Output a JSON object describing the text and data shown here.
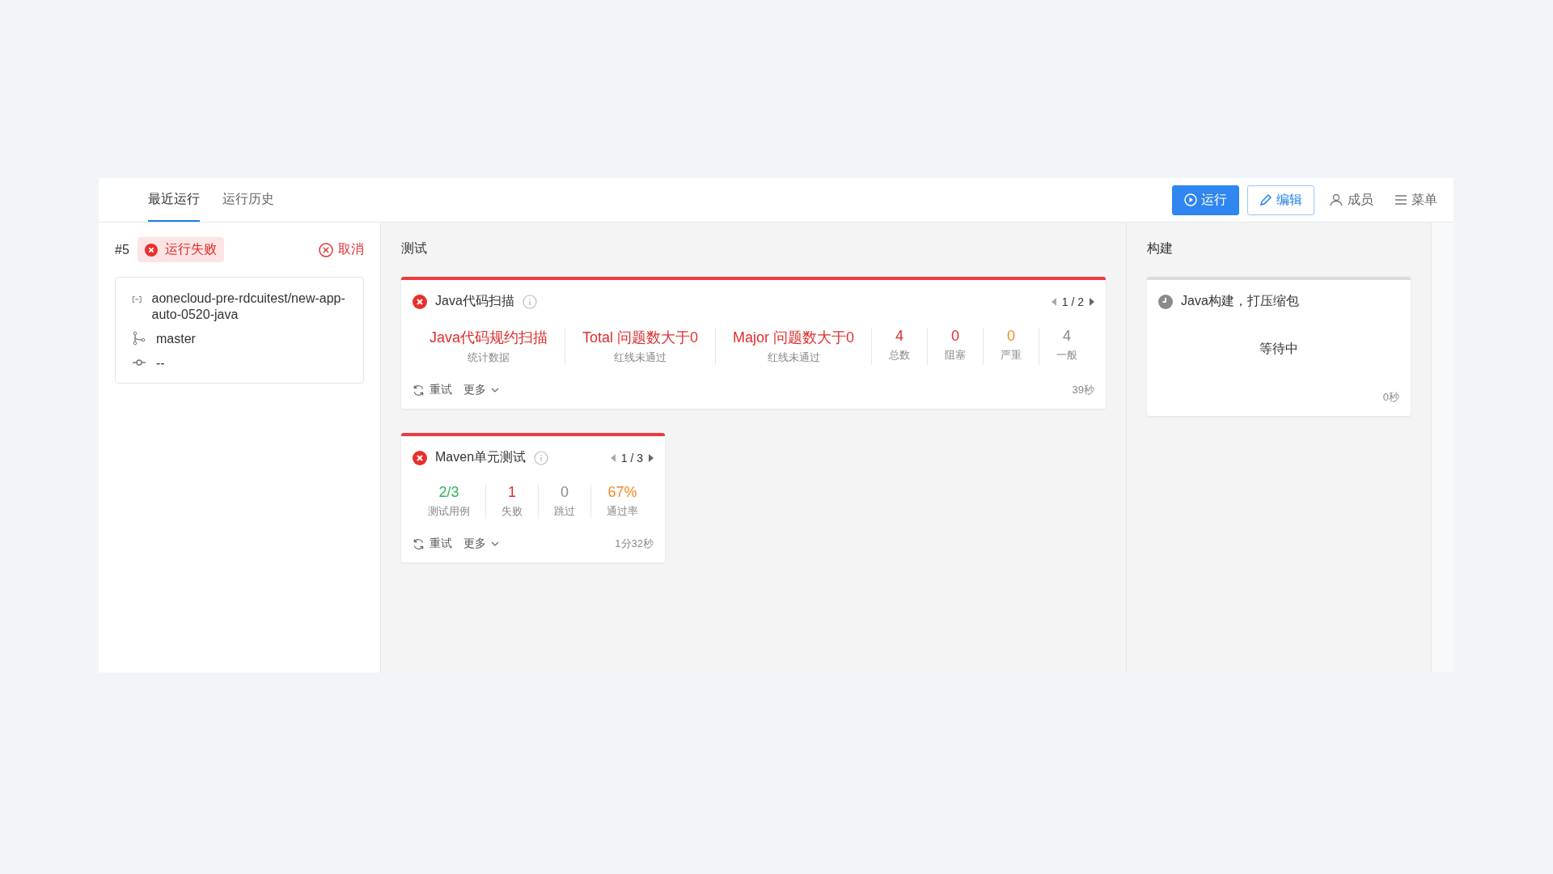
{
  "tabs": [
    {
      "label": "最近运行",
      "selected": true
    },
    {
      "label": "运行历史",
      "selected": false
    }
  ],
  "actions": [
    {
      "kind": "primary",
      "label": "运行"
    },
    {
      "kind": "outline",
      "label": "编辑"
    },
    {
      "kind": "members",
      "label": "成员"
    },
    {
      "kind": "menu",
      "label": "菜单"
    }
  ],
  "run": {
    "number": "#5",
    "status": "运行失败",
    "cancel": "取消",
    "repo": "aonecloud-pre-rdcuitest/new-app-auto-0520-java",
    "branch": "master",
    "commit": "--"
  },
  "stages": [
    {
      "title": "测试",
      "jobs": [
        {
          "kind": "failed",
          "title": "Java代码扫描",
          "page": "1 / 2",
          "metrics": [
            {
              "value": "Java代码规约扫描",
              "label": "统计数据",
              "color": "#e02d2d"
            },
            {
              "value": "Total 问题数大于0",
              "label": "红线未通过",
              "color": "#e02d2d"
            },
            {
              "value": "Major 问题数大于0",
              "label": "红线未通过",
              "color": "#e02d2d"
            },
            {
              "value": "4",
              "label": "总数",
              "color": "#e02d2d"
            },
            {
              "value": "0",
              "label": "阻塞",
              "color": "#e02d2d"
            },
            {
              "value": "0",
              "label": "严重",
              "color": "#f08a24"
            },
            {
              "value": "4",
              "label": "一般",
              "color": "#888888"
            }
          ],
          "retry": "重试",
          "more": "更多",
          "duration": "39秒"
        },
        {
          "kind": "failed",
          "title": "Maven单元测试",
          "page": "1 / 3",
          "metrics": [
            {
              "value": "2/3",
              "label": "测试用例",
              "color": "#2fb35a"
            },
            {
              "value": "1",
              "label": "失败",
              "color": "#e02d2d"
            },
            {
              "value": "0",
              "label": "跳过",
              "color": "#888888"
            },
            {
              "value": "67%",
              "label": "通过率",
              "color": "#f08a24"
            }
          ],
          "retry": "重试",
          "more": "更多",
          "duration": "1分32秒"
        }
      ]
    },
    {
      "title": "构建",
      "jobs": [
        {
          "kind": "waiting",
          "title": "Java构建，打压缩包",
          "message": "等待中",
          "duration": "0秒"
        }
      ]
    }
  ]
}
